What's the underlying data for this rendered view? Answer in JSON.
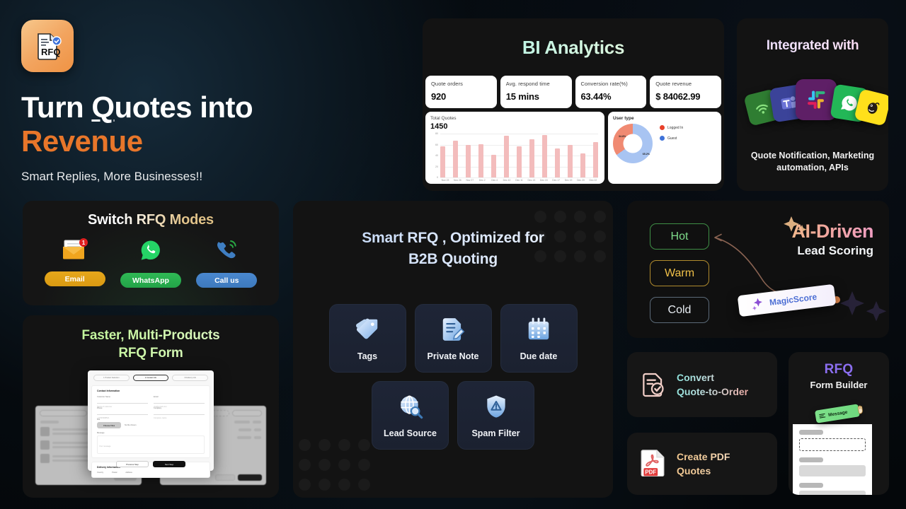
{
  "hero": {
    "logo_alt": "rfq-logo",
    "logo_text": "RFQ",
    "title_line1_a": "Turn ",
    "title_line1_u": "Q",
    "title_line1_b": "uotes into",
    "title_line2": "Revenue",
    "subtitle": "Smart Replies, More Businesses!!",
    "accent": "#e8762a"
  },
  "bi": {
    "title": "BI Analytics",
    "kpis": [
      {
        "label": "Quote orders",
        "value": "920"
      },
      {
        "label": "Avg. respond time",
        "value": "15 mins"
      },
      {
        "label": "Conversion rate(%)",
        "value": "63.44%"
      },
      {
        "label": "Quote revenue",
        "value": "$ 84062.99"
      }
    ],
    "chart_card": {
      "label": "Total Quotes",
      "value": "1450"
    },
    "donut_card": {
      "label": "User type",
      "legend": [
        {
          "name": "Logged In",
          "color": "#e8402a"
        },
        {
          "name": "Guest",
          "color": "#3f72d8"
        }
      ],
      "slice1_label": "34.8%",
      "slice2_label": "65.2%"
    }
  },
  "chart_data": [
    {
      "type": "bar",
      "title": "Total Quotes",
      "total": 1450,
      "categories": [
        "Nov 23",
        "Nov 26",
        "Nov 27",
        "Dec 2",
        "Dec 4",
        "Dec 10",
        "Dec 11",
        "Dec 13",
        "Dec 15",
        "Dec 17",
        "Dec 19",
        "Dec 20",
        "Dec 22"
      ],
      "values": [
        57,
        67,
        60,
        61,
        41,
        76,
        57,
        70,
        78,
        53,
        60,
        44,
        65
      ],
      "xlabel": "",
      "ylabel": "",
      "ylim": [
        0,
        80
      ],
      "yticks": [
        0,
        20,
        40,
        60,
        80
      ],
      "grid": true,
      "bar_color": "#f3bcbc",
      "legend": "none"
    },
    {
      "type": "pie",
      "title": "User type",
      "labels": [
        "Logged In",
        "Guest"
      ],
      "values": [
        34.8,
        65.2
      ],
      "colors": [
        "#f08a72",
        "#a8c4f2"
      ],
      "legend_colors": [
        "#e8402a",
        "#3f72d8"
      ],
      "legend": "right",
      "donut": true
    }
  ],
  "integrations": {
    "title": "Integrated with",
    "caption": "Quote Notification, Marketing automation, APIs",
    "items": [
      {
        "name": "wifi-icon",
        "color": "#2f7d32"
      },
      {
        "name": "teams-icon",
        "color": "#4a52b5"
      },
      {
        "name": "slack-icon",
        "color": "#611f69"
      },
      {
        "name": "whatsapp-icon",
        "color": "#25d366"
      },
      {
        "name": "mailchimp-icon",
        "color": "#ffe01b"
      }
    ]
  },
  "modes": {
    "title": "Switch RFQ Modes",
    "items": [
      {
        "icon": "email-icon",
        "label": "Email",
        "badge": "1"
      },
      {
        "icon": "whatsapp-icon",
        "label": "WhatsApp",
        "badge": ""
      },
      {
        "icon": "phone-icon",
        "label": "Call us",
        "badge": ""
      }
    ]
  },
  "rfq_form": {
    "title_line1": "Faster, Multi-Products",
    "title_line2": "RFQ  Form",
    "mock": {
      "steps": [
        "1 Product Selection",
        "2 Contact Info",
        "3 Delivery Info"
      ],
      "section1": "Contact Information",
      "fields": [
        {
          "label": "Customer Name",
          "placeholder": "Name of customer"
        },
        {
          "label": "Email",
          "placeholder": "yhs@gmail.com"
        },
        {
          "label": "Phone",
          "placeholder": "+12345698521"
        },
        {
          "label": "Company",
          "placeholder": "Company name"
        }
      ],
      "file_label": "File",
      "file_button": "Choose Files",
      "file_hint": "No file chosen",
      "message_label": "Message",
      "message_placeholder": "Your message",
      "section2": "Delivery Information",
      "delivery_headers": [
        "Country",
        "Postal",
        "Address"
      ],
      "prev_button": "Previous Step",
      "next_button": "Next Step"
    }
  },
  "smart": {
    "title_line1": "Smart RFQ , Optimized for",
    "title_line2": "B2B Quoting",
    "tiles_row1": [
      {
        "icon": "tag-icon",
        "label": "Tags"
      },
      {
        "icon": "note-edit-icon",
        "label": "Private Note"
      },
      {
        "icon": "calendar-icon",
        "label": "Due date"
      }
    ],
    "tiles_row2": [
      {
        "icon": "globe-search-icon",
        "label": "Lead Source"
      },
      {
        "icon": "shield-warning-icon",
        "label": "Spam Filter"
      }
    ]
  },
  "ai": {
    "title_line1": "AI-Driven",
    "title_line2": "Lead Scoring",
    "chips": [
      {
        "label": "Hot",
        "color": "#7fdc8b",
        "border": "#3f8f46"
      },
      {
        "label": "Warm",
        "color": "#f0c048",
        "border": "#b08b2e"
      },
      {
        "label": "Cold",
        "color": "#e9eef3",
        "border": "#5b6a78"
      }
    ],
    "magic_label": "MagicScore",
    "magic_icon": "sparkle-icon"
  },
  "convert_card": {
    "icon": "doc-check-icon",
    "line1": "Convert",
    "line2": "Quote-to-Order"
  },
  "pdf_card": {
    "icon": "pdf-icon",
    "icon_text": "PDF",
    "line1": "Create PDF",
    "line2": "Quotes"
  },
  "form_builder": {
    "title": "RFQ",
    "subtitle": "Form Builder",
    "chip_label": "Message",
    "chip_icon": "list-icon",
    "cursor_icon": "hand-cursor-icon"
  }
}
